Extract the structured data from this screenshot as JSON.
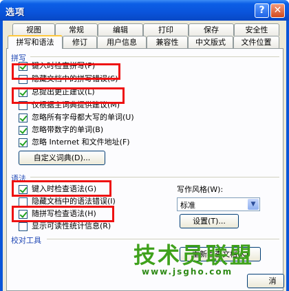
{
  "window": {
    "title": "选项",
    "help_label": "?",
    "close_label": "✕"
  },
  "tabs_row1": [
    "视图",
    "常规",
    "编辑",
    "打印",
    "保存",
    "安全性"
  ],
  "tabs_row2": [
    "拼写和语法",
    "修订",
    "用户信息",
    "兼容性",
    "中文版式",
    "文件位置"
  ],
  "active_tab": "拼写和语法",
  "spelling": {
    "group_label": "拼写",
    "options": [
      {
        "label": "键入时检查拼写(P)",
        "checked": true
      },
      {
        "label": "隐藏文档中的拼写错误(S)",
        "checked": false
      },
      {
        "label": "总提出更正建议(L)",
        "checked": true
      },
      {
        "label": "仅根据主词典提供建议(M)",
        "checked": false
      },
      {
        "label": "忽略所有字母都大写的单词(U)",
        "checked": true
      },
      {
        "label": "忽略带数字的单词(B)",
        "checked": true
      },
      {
        "label": "忽略 Internet 和文件地址(F)",
        "checked": true
      }
    ],
    "custom_dict_button": "自定义词典(D)..."
  },
  "grammar": {
    "group_label": "语法",
    "options": [
      {
        "label": "键入时检查语法(G)",
        "checked": true
      },
      {
        "label": "隐藏文档中的语法错误(I)",
        "checked": false
      },
      {
        "label": "随拼写检查语法(H)",
        "checked": true
      },
      {
        "label": "显示可读性统计信息(R)",
        "checked": false
      }
    ],
    "writing_style_label": "写作风格(W):",
    "writing_style_value": "标准",
    "settings_button": "设置(T)..."
  },
  "proofing": {
    "group_label": "校对工具",
    "recheck_button": "重新检查文档(K)"
  },
  "footer": {
    "cancel_label": "消"
  },
  "watermark": {
    "text": "技术员联盟",
    "url": "www.jsgho.com"
  },
  "colors": {
    "title_bar": "#0a55d8",
    "highlight": "#ee1111",
    "watermark": "#3fa11c",
    "group_label": "#1e46b4"
  }
}
